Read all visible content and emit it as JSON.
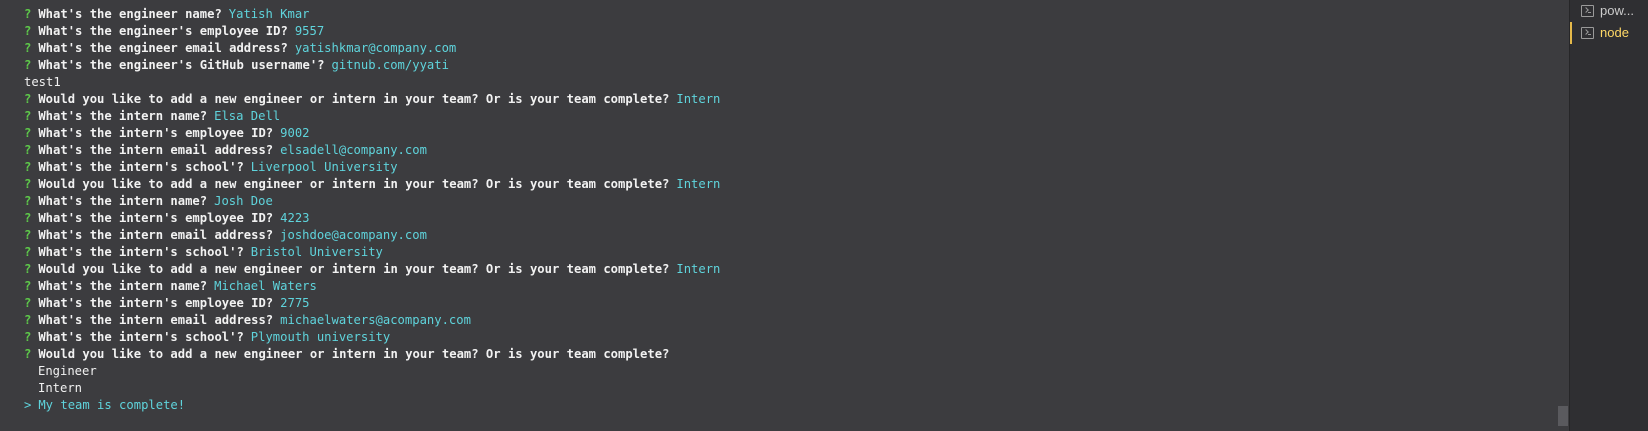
{
  "terminal": {
    "prompt_mark": "?",
    "selection_caret": ">",
    "lines": [
      {
        "kind": "qa",
        "q": "What's the engineer name?",
        "a": "Yatish Kmar"
      },
      {
        "kind": "qa",
        "q": "What's the engineer's employee ID?",
        "a": "9557"
      },
      {
        "kind": "qa",
        "q": "What's the engineer email address?",
        "a": "yatishkmar@company.com"
      },
      {
        "kind": "qa",
        "q": "What's the engineer's GitHub username'?",
        "a": "gitnub.com/yyati"
      },
      {
        "kind": "plain",
        "text": "test1"
      },
      {
        "kind": "qa",
        "q": "Would you like to add a new engineer or intern in your team? Or is your team complete?",
        "a": "Intern"
      },
      {
        "kind": "qa",
        "q": "What's the intern name?",
        "a": "Elsa Dell"
      },
      {
        "kind": "qa",
        "q": "What's the intern's employee ID?",
        "a": "9002"
      },
      {
        "kind": "qa",
        "q": "What's the intern email address?",
        "a": "elsadell@company.com"
      },
      {
        "kind": "qa",
        "q": "What's the intern's school'?",
        "a": "Liverpool University"
      },
      {
        "kind": "qa",
        "q": "Would you like to add a new engineer or intern in your team? Or is your team complete?",
        "a": "Intern"
      },
      {
        "kind": "qa",
        "q": "What's the intern name?",
        "a": "Josh Doe"
      },
      {
        "kind": "qa",
        "q": "What's the intern's employee ID?",
        "a": "4223"
      },
      {
        "kind": "qa",
        "q": "What's the intern email address?",
        "a": "joshdoe@acompany.com"
      },
      {
        "kind": "qa",
        "q": "What's the intern's school'?",
        "a": "Bristol University"
      },
      {
        "kind": "qa",
        "q": "Would you like to add a new engineer or intern in your team? Or is your team complete?",
        "a": "Intern"
      },
      {
        "kind": "qa",
        "q": "What's the intern name?",
        "a": "Michael Waters"
      },
      {
        "kind": "qa",
        "q": "What's the intern's employee ID?",
        "a": "2775"
      },
      {
        "kind": "qa",
        "q": "What's the intern email address?",
        "a": "michaelwaters@acompany.com"
      },
      {
        "kind": "qa",
        "q": "What's the intern's school'?",
        "a": "Plymouth university"
      },
      {
        "kind": "qa",
        "q": "Would you like to add a new engineer or intern in your team? Or is your team complete?",
        "a": ""
      },
      {
        "kind": "choice",
        "text": "Engineer"
      },
      {
        "kind": "choice",
        "text": "Intern"
      },
      {
        "kind": "selected",
        "text": "My team is complete!"
      }
    ]
  },
  "sidebar": {
    "tabs": [
      {
        "label": "pow...",
        "active": false,
        "icon": "terminal-icon"
      },
      {
        "label": "node",
        "active": true,
        "icon": "terminal-icon"
      }
    ]
  },
  "colors": {
    "background": "#3c3c3f",
    "prompt_green": "#5ec94a",
    "answer_cyan": "#5fd4dc",
    "active_tab_yellow": "#ffd866"
  }
}
